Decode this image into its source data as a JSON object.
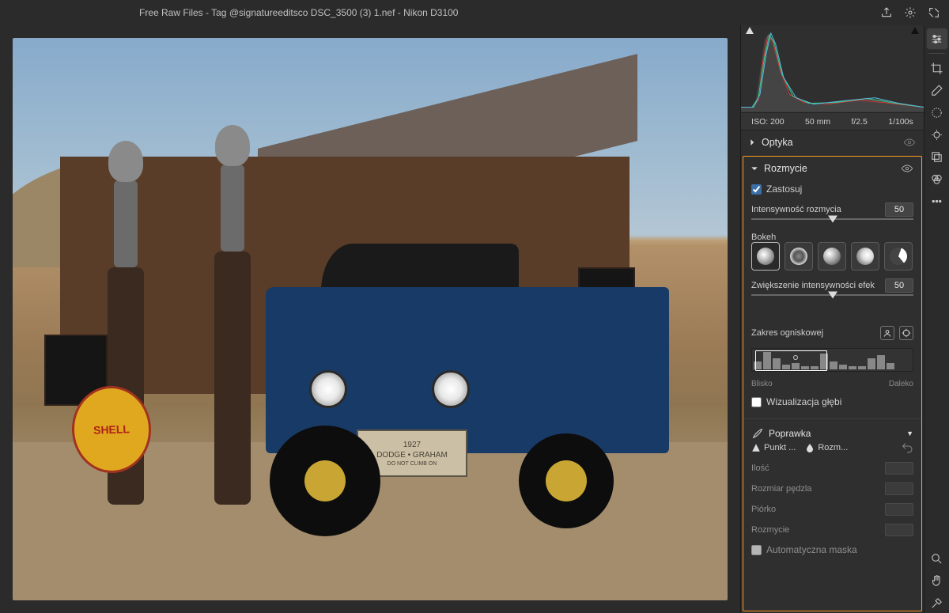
{
  "topbar": {
    "title": "Free Raw Files - Tag @signatureeditsco DSC_3500 (3) 1.nef  -  Nikon D3100"
  },
  "histogram": {
    "iso": "ISO: 200",
    "focal": "50 mm",
    "aperture": "f/2.5",
    "shutter": "1/100s"
  },
  "sections": {
    "optyka": {
      "title": "Optyka"
    },
    "rozmycie": {
      "title": "Rozmycie",
      "apply_label": "Zastosuj",
      "apply_checked": true,
      "intensity_label": "Intensywność rozmycia",
      "intensity_value": "50",
      "bokeh_label": "Bokeh",
      "bokeh_options": [
        "bokeh-soft",
        "bokeh-ring",
        "bokeh-classic",
        "bokeh-swirl",
        "bokeh-blade"
      ],
      "bokeh_selected": 0,
      "boost_label": "Zwiększenie intensywności efek",
      "boost_value": "50",
      "focal_label": "Zakres ogniskowej",
      "near_label": "Blisko",
      "far_label": "Daleko",
      "depth_vis_label": "Wizualizacja głębi",
      "depth_vis_checked": false
    },
    "poprawka": {
      "title": "Poprawka",
      "mode_point": "Punkt ...",
      "mode_blur": "Rozm...",
      "amount": "Ilość",
      "brush_size": "Rozmiar pędzla",
      "feather": "Piórko",
      "blur": "Rozmycie",
      "automask": "Automatyczna maska",
      "automask_checked": false
    }
  },
  "scene": {
    "sign_text": "SHELL",
    "plate_year": "1927",
    "plate_make": "DODGE • GRAHAM",
    "plate_note": "DO NOT CLIMB ON"
  }
}
